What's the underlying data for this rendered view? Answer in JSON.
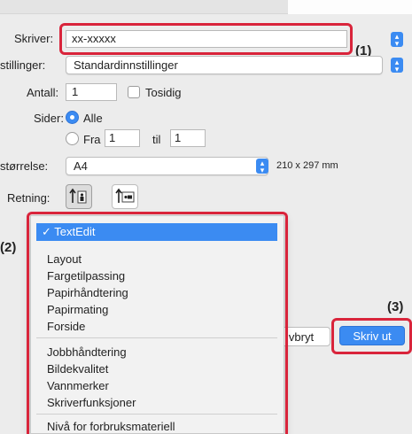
{
  "printer": {
    "label": "Skriver:",
    "value": "xx-xxxxx"
  },
  "presets": {
    "label": "stillinger:",
    "value": "Standardinnstillinger"
  },
  "copies": {
    "label": "Antall:",
    "value": "1",
    "two_sided_label": "Tosidig"
  },
  "pages": {
    "label": "Sider:",
    "all_label": "Alle",
    "from_label": "Fra",
    "from_value": "1",
    "to_label": "til",
    "to_value": "1"
  },
  "paper_size": {
    "label": "størrelse:",
    "value": "A4",
    "dimensions": "210 x 297 mm"
  },
  "orientation": {
    "label": "Retning:"
  },
  "section_menu": {
    "selected": "TextEdit",
    "groups": [
      [
        "Layout",
        "Fargetilpassing",
        "Papirhåndtering",
        "Papirmating",
        "Forside"
      ],
      [
        "Jobbhåndtering",
        "Bildekvalitet",
        "Vannmerker",
        "Skriverfunksjoner"
      ],
      [
        "Nivå for forbruksmateriell"
      ]
    ]
  },
  "buttons": {
    "cancel": "vbryt",
    "print": "Skriv ut"
  },
  "callouts": {
    "one": "(1)",
    "two": "(2)",
    "three": "(3)"
  },
  "colors": {
    "accent": "#3b8bf2",
    "highlight_box": "#d9243b"
  }
}
